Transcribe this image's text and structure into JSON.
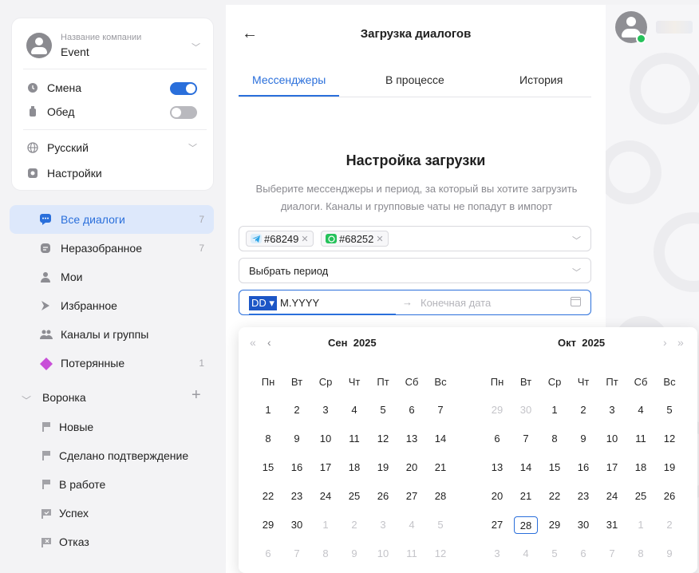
{
  "company": {
    "caption": "Название компании",
    "name": "Event"
  },
  "toggles": {
    "shift_label": "Смена",
    "shift_on": true,
    "lunch_label": "Обед",
    "lunch_on": false
  },
  "settings": {
    "language": "Русский",
    "settings_label": "Настройки"
  },
  "nav": [
    {
      "label": "Все диалоги",
      "count": "7",
      "icon": "chat-icon",
      "active": true
    },
    {
      "label": "Неразобранное",
      "count": "7",
      "icon": "inbox-icon"
    },
    {
      "label": "Мои",
      "count": "",
      "icon": "person-icon"
    },
    {
      "label": "Избранное",
      "count": "",
      "icon": "star-icon"
    },
    {
      "label": "Каналы и группы",
      "count": "",
      "icon": "group-icon"
    },
    {
      "label": "Потерянные",
      "count": "1",
      "icon": "diamond-icon"
    }
  ],
  "funnel": {
    "label": "Воронка",
    "add": "+",
    "items": [
      "Новые",
      "Сделано подтверждение",
      "В работе",
      "Успех",
      "Отказ"
    ]
  },
  "panel": {
    "title": "Загрузка диалогов",
    "tabs": [
      "Мессенджеры",
      "В процессе",
      "История"
    ],
    "section_title": "Настройка загрузки",
    "section_desc_1": "Выберите мессенджеры и период, за который вы хотите загрузить",
    "section_desc_2": "диалоги. Каналы и групповые чаты не попадут в импорт",
    "chips": [
      {
        "label": "#68249",
        "icon": "telegram-icon",
        "color": "#2aa3e6"
      },
      {
        "label": "#68252",
        "icon": "whatsapp-icon",
        "color": "#25c25a"
      }
    ],
    "period_placeholder": "Выбрать период",
    "date_selected": "DD ▾",
    "date_rest": "M.YYYY",
    "end_placeholder": "Конечная дата"
  },
  "calendar": {
    "weekdays": [
      "Пн",
      "Вт",
      "Ср",
      "Чт",
      "Пт",
      "Сб",
      "Вс"
    ],
    "left": {
      "month": "Сен",
      "year": "2025",
      "days": [
        [
          "1",
          "2",
          "3",
          "4",
          "5",
          "6",
          "7"
        ],
        [
          "8",
          "9",
          "10",
          "11",
          "12",
          "13",
          "14"
        ],
        [
          "15",
          "16",
          "17",
          "18",
          "19",
          "20",
          "21"
        ],
        [
          "22",
          "23",
          "24",
          "25",
          "26",
          "27",
          "28"
        ],
        [
          "29",
          "30",
          "1",
          "2",
          "3",
          "4",
          "5"
        ],
        [
          "6",
          "7",
          "8",
          "9",
          "10",
          "11",
          "12"
        ]
      ],
      "muted_from": 30
    },
    "right": {
      "month": "Окт",
      "year": "2025",
      "days": [
        [
          "29",
          "30",
          "1",
          "2",
          "3",
          "4",
          "5"
        ],
        [
          "6",
          "7",
          "8",
          "9",
          "10",
          "11",
          "12"
        ],
        [
          "13",
          "14",
          "15",
          "16",
          "17",
          "18",
          "19"
        ],
        [
          "20",
          "21",
          "22",
          "23",
          "24",
          "25",
          "26"
        ],
        [
          "27",
          "28",
          "29",
          "30",
          "31",
          "1",
          "2"
        ],
        [
          "3",
          "4",
          "5",
          "6",
          "7",
          "8",
          "9"
        ]
      ],
      "muted_before": 2,
      "muted_from": 33,
      "today_index": 29
    }
  },
  "colors": {
    "accent": "#2a6fdb",
    "telegram": "#2aa3e6",
    "whatsapp": "#25c25a",
    "lost": "#c84fd8"
  }
}
